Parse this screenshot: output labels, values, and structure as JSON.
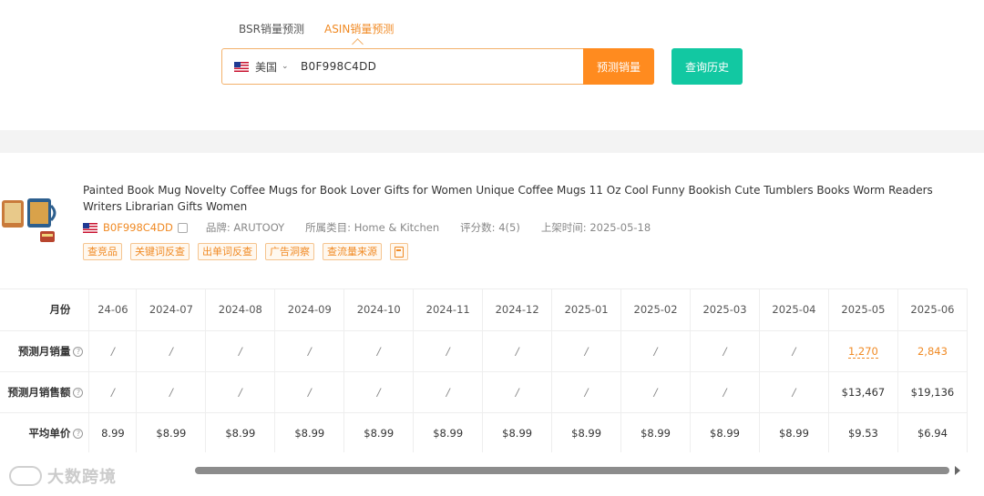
{
  "search": {
    "tabs": [
      {
        "label": "BSR销量预测",
        "active": false
      },
      {
        "label": "ASIN销量预测",
        "active": true
      }
    ],
    "country": "美国",
    "asin_value": "B0F998C4DD",
    "predict_label": "预测销量",
    "history_label": "查询历史"
  },
  "product": {
    "title": "Painted Book Mug Novelty Coffee Mugs for Book Lover Gifts for Women Unique Coffee Mugs 11 Oz Cool Funny Bookish Cute Tumblers Books Worm Readers Writers Librarian Gifts Women",
    "asin": "B0F998C4DD",
    "brand": "品牌: ARUTOOY",
    "category": "所属类目: Home & Kitchen",
    "rating": "评分数: 4(5)",
    "listed": "上架时间: 2025-05-18",
    "tags": [
      "查竞品",
      "关键词反查",
      "出单词反查",
      "广告洞察",
      "查流量来源"
    ]
  },
  "table": {
    "month_header": "月份",
    "months": [
      "24-06",
      "2024-07",
      "2024-08",
      "2024-09",
      "2024-10",
      "2024-11",
      "2024-12",
      "2025-01",
      "2025-02",
      "2025-03",
      "2025-04",
      "2025-05",
      "2025-06"
    ],
    "rows": [
      {
        "label": "预测月销量",
        "values": [
          "/",
          "/",
          "/",
          "/",
          "/",
          "/",
          "/",
          "/",
          "/",
          "/",
          "/",
          "1,270",
          "2,843"
        ]
      },
      {
        "label": "预测月销售额",
        "values": [
          "/",
          "/",
          "/",
          "/",
          "/",
          "/",
          "/",
          "/",
          "/",
          "/",
          "/",
          "$13,467",
          "$19,136"
        ]
      },
      {
        "label": "平均单价",
        "values": [
          "8.99",
          "$8.99",
          "$8.99",
          "$8.99",
          "$8.99",
          "$8.99",
          "$8.99",
          "$8.99",
          "$8.99",
          "$8.99",
          "$8.99",
          "$9.53",
          "$6.94"
        ]
      }
    ]
  },
  "watermark": "大数跨境",
  "colors": {
    "accent": "#ff8b1f",
    "teal": "#12c8a2"
  }
}
